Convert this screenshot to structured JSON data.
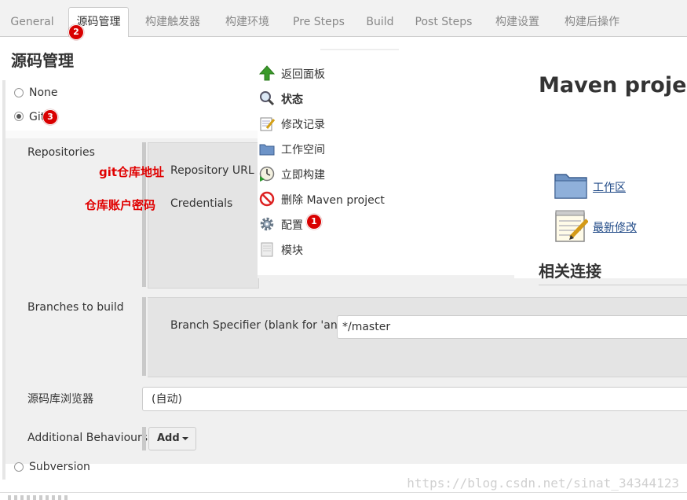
{
  "tabs": [
    {
      "label": "General"
    },
    {
      "label": "源码管理"
    },
    {
      "label": "构建触发器"
    },
    {
      "label": "构建环境"
    },
    {
      "label": "Pre Steps"
    },
    {
      "label": "Build"
    },
    {
      "label": "Post Steps"
    },
    {
      "label": "构建设置"
    },
    {
      "label": "构建后操作"
    }
  ],
  "scm": {
    "title": "源码管理",
    "none_label": "None",
    "git_label": "Git",
    "subversion_label": "Subversion",
    "selected": "Git"
  },
  "git": {
    "repositories_label": "Repositories",
    "repo_url_note": "git仓库地址",
    "repo_url_label": "Repository URL",
    "credentials_note": "仓库账户密码",
    "credentials_label": "Credentials",
    "branches_label": "Branches to build",
    "branch_specifier_label": "Branch Specifier (blank for 'any')",
    "branch_specifier_value": "*/master",
    "browser_label": "源码库浏览器",
    "browser_value": "(自动)",
    "additional_label": "Additional Behaviours",
    "add_button": "Add"
  },
  "sidebar_menu": [
    {
      "label": "返回面板",
      "icon": "up-arrow-icon"
    },
    {
      "label": "状态",
      "icon": "magnifier-icon"
    },
    {
      "label": "修改记录",
      "icon": "notepad-icon"
    },
    {
      "label": "工作空间",
      "icon": "folder-icon"
    },
    {
      "label": "立即构建",
      "icon": "clock-icon"
    },
    {
      "label": "删除 Maven project",
      "icon": "no-entry-icon"
    },
    {
      "label": "配置",
      "icon": "gear-icon"
    },
    {
      "label": "模块",
      "icon": "document-icon"
    }
  ],
  "project": {
    "title": "Maven project",
    "workspace_link": "工作区",
    "changes_link": "最新修改",
    "related_title": "相关连接"
  },
  "badges": {
    "config": "1",
    "scm_tab": "2",
    "git": "3"
  },
  "colors": {
    "accent_red": "#e00000",
    "badge": "#d90000",
    "green_arrow": "#3a9a2a"
  },
  "watermark": "https://blog.csdn.net/sinat_34344123"
}
